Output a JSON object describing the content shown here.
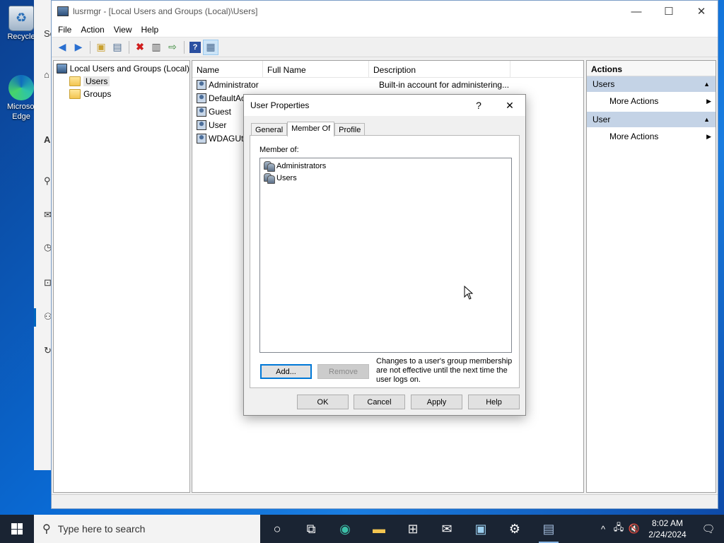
{
  "desktop": {
    "icons": [
      {
        "label": "Recycle"
      },
      {
        "label": "Microsoft Edge"
      }
    ],
    "bg_window": {
      "partial_text": [
        "Se",
        "A"
      ]
    }
  },
  "mmc": {
    "title": "lusrmgr - [Local Users and Groups (Local)\\Users]",
    "menu": [
      "File",
      "Action",
      "View",
      "Help"
    ],
    "tree": {
      "root": "Local Users and Groups (Local)",
      "children": [
        "Users",
        "Groups"
      ]
    },
    "list": {
      "columns": [
        "Name",
        "Full Name",
        "Description"
      ],
      "rows": [
        {
          "name": "Administrator",
          "full_name": "",
          "description": "Built-in account for administering..."
        },
        {
          "name": "DefaultAc",
          "full_name": "",
          "description": ""
        },
        {
          "name": "Guest",
          "full_name": "",
          "description": ""
        },
        {
          "name": "User",
          "full_name": "",
          "description": ""
        },
        {
          "name": "WDAGUti",
          "full_name": "",
          "description": ""
        }
      ]
    },
    "actions": {
      "title": "Actions",
      "sections": [
        {
          "label": "Users",
          "item": "More Actions"
        },
        {
          "label": "User",
          "item": "More Actions"
        }
      ]
    }
  },
  "dialog": {
    "title": "User Properties",
    "help_glyph": "?",
    "close_glyph": "✕",
    "tabs": [
      "General",
      "Member Of",
      "Profile"
    ],
    "active_tab": "Member Of",
    "member_of_label": "Member of:",
    "members": [
      "Administrators",
      "Users"
    ],
    "add_label": "Add...",
    "remove_label": "Remove",
    "note": "Changes to a user's group membership are not effective until the next time the user logs on.",
    "buttons": [
      "OK",
      "Cancel",
      "Apply",
      "Help"
    ]
  },
  "taskbar": {
    "search_placeholder": "Type here to search",
    "time": "8:02 AM",
    "date": "2/24/2024"
  }
}
